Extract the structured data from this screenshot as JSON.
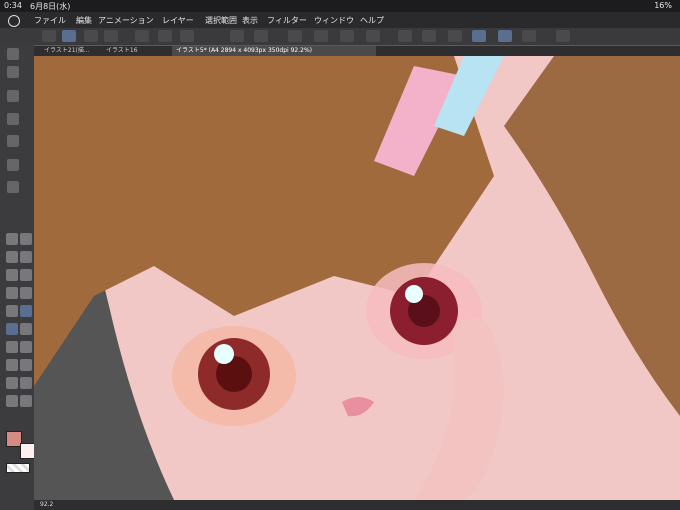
{
  "status": {
    "time": "0:34",
    "date": "6月8日(水)",
    "battery": "16%"
  },
  "menu": {
    "items": [
      "ファイル",
      "編集",
      "アニメーション",
      "レイヤー",
      "選択範囲",
      "表示",
      "フィルター",
      "ウィンドウ",
      "ヘルプ"
    ]
  },
  "tabs": [
    {
      "label": "イラスト21(描..."
    },
    {
      "label": "イラスト16"
    },
    {
      "label": "イラスト5* (A4 2894 x 4093px 350dpi 92.2%)"
    }
  ],
  "bottom": {
    "zoom": "92.2"
  },
  "colors": {
    "main": "#d58a83",
    "sub": "#ffeef2",
    "accent": "#5a6f8f"
  }
}
